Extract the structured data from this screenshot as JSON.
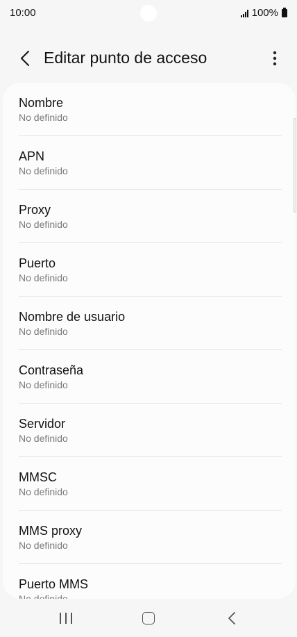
{
  "status_bar": {
    "time": "10:00",
    "battery": "100%",
    "icons": [
      "signal-icon",
      "battery-icon"
    ]
  },
  "header": {
    "title": "Editar punto de acceso",
    "back_icon": "chevron-left-icon",
    "more_icon": "more-vertical-icon"
  },
  "settings": [
    {
      "label": "Nombre",
      "value": "No definido"
    },
    {
      "label": "APN",
      "value": "No definido"
    },
    {
      "label": "Proxy",
      "value": "No definido"
    },
    {
      "label": "Puerto",
      "value": "No definido"
    },
    {
      "label": "Nombre de usuario",
      "value": "No definido"
    },
    {
      "label": "Contraseña",
      "value": "No definido"
    },
    {
      "label": "Servidor",
      "value": "No definido"
    },
    {
      "label": "MMSC",
      "value": "No definido"
    },
    {
      "label": "MMS proxy",
      "value": "No definido"
    },
    {
      "label": "Puerto MMS",
      "value": "No definido"
    }
  ],
  "nav_bar": {
    "icons": [
      "recents-icon",
      "home-icon",
      "back-icon"
    ]
  },
  "colors": {
    "background": "#f6f6f6",
    "card": "#fcfcfc",
    "secondary_text": "#7a7a7a",
    "divider": "#e4e4e4"
  }
}
